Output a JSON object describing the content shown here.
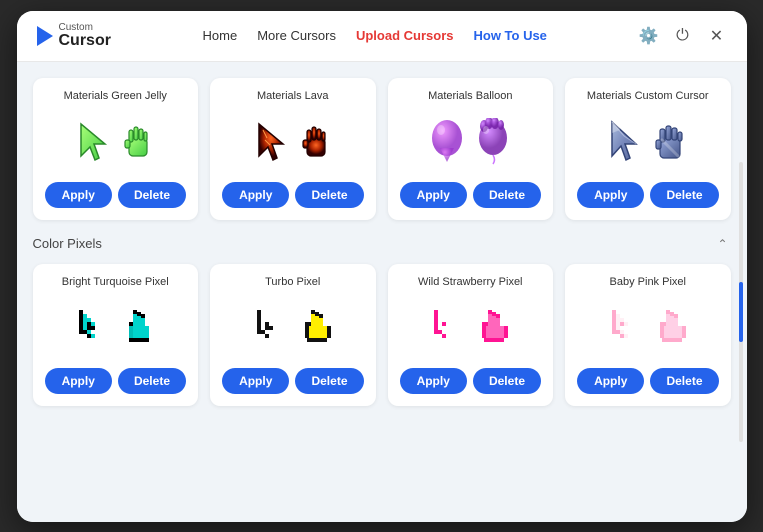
{
  "app": {
    "logo_custom": "Custom",
    "logo_cursor": "Cursor"
  },
  "nav": {
    "home": "Home",
    "more_cursors": "More Cursors",
    "upload_cursors": "Upload Cursors",
    "how_to_use": "How To Use"
  },
  "section1": {
    "label": ""
  },
  "section2": {
    "label": "Color Pixels"
  },
  "cards_row1": [
    {
      "title": "Materials Green Jelly",
      "apply_label": "Apply",
      "delete_label": "Delete",
      "cursor_type": "green_jelly"
    },
    {
      "title": "Materials Lava",
      "apply_label": "Apply",
      "delete_label": "Delete",
      "cursor_type": "lava"
    },
    {
      "title": "Materials Balloon",
      "apply_label": "Apply",
      "delete_label": "Delete",
      "cursor_type": "balloon"
    },
    {
      "title": "Materials Custom Cursor",
      "apply_label": "Apply",
      "delete_label": "Delete",
      "cursor_type": "custom_cursor"
    }
  ],
  "cards_row2": [
    {
      "title": "Bright Turquoise Pixel",
      "apply_label": "Apply",
      "delete_label": "Delete",
      "cursor_type": "turquoise_pixel"
    },
    {
      "title": "Turbo Pixel",
      "apply_label": "Apply",
      "delete_label": "Delete",
      "cursor_type": "turbo_pixel"
    },
    {
      "title": "Wild Strawberry Pixel",
      "apply_label": "Apply",
      "delete_label": "Delete",
      "cursor_type": "strawberry_pixel"
    },
    {
      "title": "Baby Pink Pixel",
      "apply_label": "Apply",
      "delete_label": "Delete",
      "cursor_type": "baby_pink_pixel"
    }
  ],
  "colors": {
    "apply_btn": "#2563eb",
    "delete_btn": "#2563eb",
    "nav_upload": "#e53935",
    "nav_howto": "#2563eb"
  }
}
